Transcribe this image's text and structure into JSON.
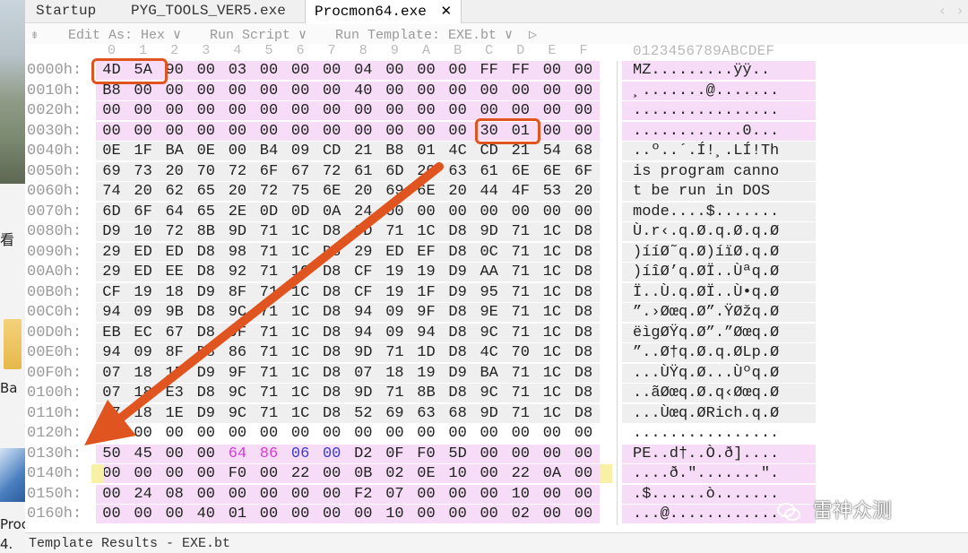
{
  "desktop": {
    "label_kan": "看",
    "label_ba": "Ba",
    "label_proc": "Proc",
    "label_4": "4."
  },
  "tabs": [
    {
      "label": "Startup"
    },
    {
      "label": "PYG_TOOLS_VER5.exe"
    },
    {
      "label": "Procmon64.exe",
      "active": true
    }
  ],
  "tab_close_glyph": "✕",
  "toolbar": {
    "edit_as": "Edit As: Hex",
    "run_script": "Run Script",
    "run_template": "Run Template: EXE.bt",
    "dropdown_glyph": "∨",
    "play_glyph": "▷"
  },
  "column_headers": [
    "0",
    "1",
    "2",
    "3",
    "4",
    "5",
    "6",
    "7",
    "8",
    "9",
    "A",
    "B",
    "C",
    "D",
    "E",
    "F"
  ],
  "ascii_header": "0123456789ABCDEF",
  "rows": [
    {
      "addr": "0000h:",
      "bytes": [
        "4D",
        "5A",
        "90",
        "00",
        "03",
        "00",
        "00",
        "00",
        "04",
        "00",
        "00",
        "00",
        "FF",
        "FF",
        "00",
        "00"
      ],
      "ascii": "MZ.........ÿÿ..",
      "shade": "pink",
      "ashade": "pink"
    },
    {
      "addr": "0010h:",
      "bytes": [
        "B8",
        "00",
        "00",
        "00",
        "00",
        "00",
        "00",
        "00",
        "40",
        "00",
        "00",
        "00",
        "00",
        "00",
        "00",
        "00"
      ],
      "ascii": "¸.......@.......",
      "shade": "pink",
      "ashade": "pink"
    },
    {
      "addr": "0020h:",
      "bytes": [
        "00",
        "00",
        "00",
        "00",
        "00",
        "00",
        "00",
        "00",
        "00",
        "00",
        "00",
        "00",
        "00",
        "00",
        "00",
        "00"
      ],
      "ascii": "................",
      "shade": "pink",
      "ashade": "pink"
    },
    {
      "addr": "0030h:",
      "bytes": [
        "00",
        "00",
        "00",
        "00",
        "00",
        "00",
        "00",
        "00",
        "00",
        "00",
        "00",
        "00",
        "30",
        "01",
        "00",
        "00"
      ],
      "ascii": "............0...",
      "shade": "pink",
      "ashade": "pink"
    },
    {
      "addr": "0040h:",
      "bytes": [
        "0E",
        "1F",
        "BA",
        "0E",
        "00",
        "B4",
        "09",
        "CD",
        "21",
        "B8",
        "01",
        "4C",
        "CD",
        "21",
        "54",
        "68"
      ],
      "ascii": "..º..´.Í!¸.LÍ!Th",
      "shade": "gray",
      "ashade": "gray"
    },
    {
      "addr": "0050h:",
      "bytes": [
        "69",
        "73",
        "20",
        "70",
        "72",
        "6F",
        "67",
        "72",
        "61",
        "6D",
        "20",
        "63",
        "61",
        "6E",
        "6E",
        "6F"
      ],
      "ascii": "is program canno",
      "shade": "gray",
      "ashade": "gray"
    },
    {
      "addr": "0060h:",
      "bytes": [
        "74",
        "20",
        "62",
        "65",
        "20",
        "72",
        "75",
        "6E",
        "20",
        "69",
        "6E",
        "20",
        "44",
        "4F",
        "53",
        "20"
      ],
      "ascii": "t be run in DOS ",
      "shade": "gray",
      "ashade": "gray"
    },
    {
      "addr": "0070h:",
      "bytes": [
        "6D",
        "6F",
        "64",
        "65",
        "2E",
        "0D",
        "0D",
        "0A",
        "24",
        "00",
        "00",
        "00",
        "00",
        "00",
        "00",
        "00"
      ],
      "ascii": "mode....$.......",
      "shade": "gray",
      "ashade": "gray"
    },
    {
      "addr": "0080h:",
      "bytes": [
        "D9",
        "10",
        "72",
        "8B",
        "9D",
        "71",
        "1C",
        "D8",
        "9D",
        "71",
        "1C",
        "D8",
        "9D",
        "71",
        "1C",
        "D8"
      ],
      "ascii": "Ù.r‹.q.Ø.q.Ø.q.Ø",
      "shade": "gray",
      "ashade": "gray"
    },
    {
      "addr": "0090h:",
      "bytes": [
        "29",
        "ED",
        "ED",
        "D8",
        "98",
        "71",
        "1C",
        "D8",
        "29",
        "ED",
        "EF",
        "D8",
        "0C",
        "71",
        "1C",
        "D8"
      ],
      "ascii": ")ííØ˜q.Ø)íïØ.q.Ø",
      "shade": "gray",
      "ashade": "gray"
    },
    {
      "addr": "00A0h:",
      "bytes": [
        "29",
        "ED",
        "EE",
        "D8",
        "92",
        "71",
        "1C",
        "D8",
        "CF",
        "19",
        "19",
        "D9",
        "AA",
        "71",
        "1C",
        "D8"
      ],
      "ascii": ")íîØ’q.ØÏ..Ùªq.Ø",
      "shade": "gray",
      "ashade": "gray"
    },
    {
      "addr": "00B0h:",
      "bytes": [
        "CF",
        "19",
        "18",
        "D9",
        "8F",
        "71",
        "1C",
        "D8",
        "CF",
        "19",
        "1F",
        "D9",
        "95",
        "71",
        "1C",
        "D8"
      ],
      "ascii": "Ï..Ù.q.ØÏ..Ù•q.Ø",
      "shade": "gray",
      "ashade": "gray"
    },
    {
      "addr": "00C0h:",
      "bytes": [
        "94",
        "09",
        "9B",
        "D8",
        "9C",
        "71",
        "1C",
        "D8",
        "94",
        "09",
        "9F",
        "D8",
        "9E",
        "71",
        "1C",
        "D8"
      ],
      "ascii": "”.›Øœq.Ø”.ŸØžq.Ø",
      "shade": "gray",
      "ashade": "gray"
    },
    {
      "addr": "00D0h:",
      "bytes": [
        "EB",
        "EC",
        "67",
        "D8",
        "9F",
        "71",
        "1C",
        "D8",
        "94",
        "09",
        "94",
        "D8",
        "9C",
        "71",
        "1C",
        "D8"
      ],
      "ascii": "ëìgØŸq.Ø”.”Øœq.Ø",
      "shade": "gray",
      "ashade": "gray"
    },
    {
      "addr": "00E0h:",
      "bytes": [
        "94",
        "09",
        "8F",
        "D8",
        "86",
        "71",
        "1C",
        "D8",
        "9D",
        "71",
        "1D",
        "D8",
        "4C",
        "70",
        "1C",
        "D8"
      ],
      "ascii": "”..Ø†q.Ø.q.ØLp.Ø",
      "shade": "gray",
      "ashade": "gray"
    },
    {
      "addr": "00F0h:",
      "bytes": [
        "07",
        "18",
        "1F",
        "D9",
        "9F",
        "71",
        "1C",
        "D8",
        "07",
        "18",
        "19",
        "D9",
        "BA",
        "71",
        "1C",
        "D8"
      ],
      "ascii": "...ÙŸq.Ø...Ùºq.Ø",
      "shade": "gray",
      "ashade": "gray"
    },
    {
      "addr": "0100h:",
      "bytes": [
        "07",
        "18",
        "E3",
        "D8",
        "9C",
        "71",
        "1C",
        "D8",
        "9D",
        "71",
        "8B",
        "D8",
        "9C",
        "71",
        "1C",
        "D8"
      ],
      "ascii": "..ãØœq.Ø.q‹Øœq.Ø",
      "shade": "gray",
      "ashade": "gray"
    },
    {
      "addr": "0110h:",
      "bytes": [
        "07",
        "18",
        "1E",
        "D9",
        "9C",
        "71",
        "1C",
        "D8",
        "52",
        "69",
        "63",
        "68",
        "9D",
        "71",
        "1C",
        "D8"
      ],
      "ascii": "...Ùœq.ØRich.q.Ø",
      "shade": "gray",
      "ashade": "gray"
    },
    {
      "addr": "0120h:",
      "bytes": [
        "00",
        "00",
        "00",
        "00",
        "00",
        "00",
        "00",
        "00",
        "00",
        "00",
        "00",
        "00",
        "00",
        "00",
        "00",
        "00"
      ],
      "ascii": "................",
      "shade": "none",
      "ashade": "none"
    },
    {
      "addr": "0130h:",
      "bytes": [
        "50",
        "45",
        "00",
        "00",
        "64",
        "86",
        "06",
        "00",
        "D2",
        "0F",
        "F0",
        "5D",
        "00",
        "00",
        "00",
        "00"
      ],
      "ascii": "PE..d†..Ò.ð]....",
      "shade": "pink",
      "ashade": "pink"
    },
    {
      "addr": "0140h:",
      "bytes": [
        "00",
        "00",
        "00",
        "00",
        "F0",
        "00",
        "22",
        "00",
        "0B",
        "02",
        "0E",
        "10",
        "00",
        "22",
        "0A",
        "00"
      ],
      "ascii": "....ð.\".......\".",
      "shade": "pink",
      "ashade": "pink"
    },
    {
      "addr": "0150h:",
      "bytes": [
        "00",
        "24",
        "08",
        "00",
        "00",
        "00",
        "00",
        "00",
        "F2",
        "07",
        "00",
        "00",
        "00",
        "10",
        "00",
        "00"
      ],
      "ascii": ".$......ò.......",
      "shade": "pink",
      "ashade": "pink"
    },
    {
      "addr": "0160h:",
      "bytes": [
        "00",
        "00",
        "00",
        "40",
        "01",
        "00",
        "00",
        "00",
        "00",
        "10",
        "00",
        "00",
        "00",
        "02",
        "00",
        "00"
      ],
      "ascii": "...@............",
      "shade": "pink",
      "ashade": "pink"
    }
  ],
  "colors": {
    "pink_shade": "#f7dcf7",
    "gray_shade": "#efefef",
    "highlight_box": "#e0541f",
    "arrow": "#e0541f",
    "machine_bytes": "#d43bd4",
    "section_bytes": "#3a3ad0"
  },
  "highlights": [
    "MZ signature (4D 5A)",
    "e_lfanew (30 01)"
  ],
  "status_bar": {
    "text": "Template Results - EXE.bt"
  },
  "watermark": {
    "text": "雷神众测"
  }
}
